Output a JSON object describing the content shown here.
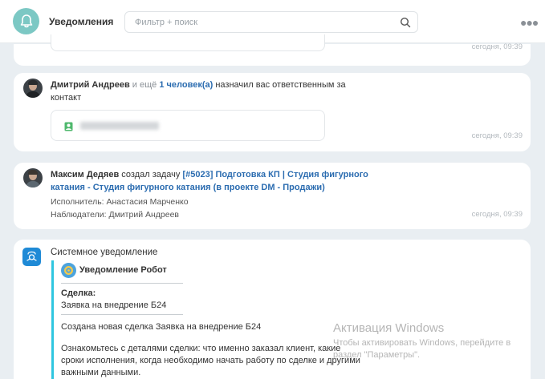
{
  "header": {
    "title": "Уведомления",
    "search_placeholder": "Фильтр + поиск"
  },
  "notifications": [
    {
      "time": "сегодня, 09:39"
    },
    {
      "author": "Дмитрий Андреев",
      "and_more": "и ещё",
      "people_link": "1 человек(а)",
      "action": "назначил вас ответственным за контакт",
      "time": "сегодня, 09:39"
    },
    {
      "author": "Максим Дедяев",
      "action": "создал задачу",
      "task_link": "[#5023] Подготовка КП | Студия фигурного катания - Студия фигурного катания (в проекте DM - Продажи)",
      "executor": "Исполнитель: Анастасия Марченко",
      "observers": "Наблюдатели: Дмитрий Андреев",
      "time": "сегодня, 09:39"
    }
  ],
  "system": {
    "title": "Системное уведомление",
    "robot_name": "Уведомление Робот",
    "deal_label": "Сделка:",
    "deal_link": "Заявка на внедрение Б24",
    "created_text": "Создана новая сделка Заявка на внедрение Б24",
    "details_text": "Ознакомьтесь с деталями сделки: что именно заказал клиент, какие сроки исполнения, когда необходимо начать работу по сделке и другими важными данными."
  },
  "watermark": {
    "title": "Активация Windows",
    "subtitle": "Чтобы активировать Windows, перейдите в раздел \"Параметры\"."
  },
  "colors": {
    "accent": "#2b6cb0",
    "bell": "#7cc8c4",
    "system_icon": "#1f8ad6",
    "quote_bar": "#2fc6e0"
  }
}
